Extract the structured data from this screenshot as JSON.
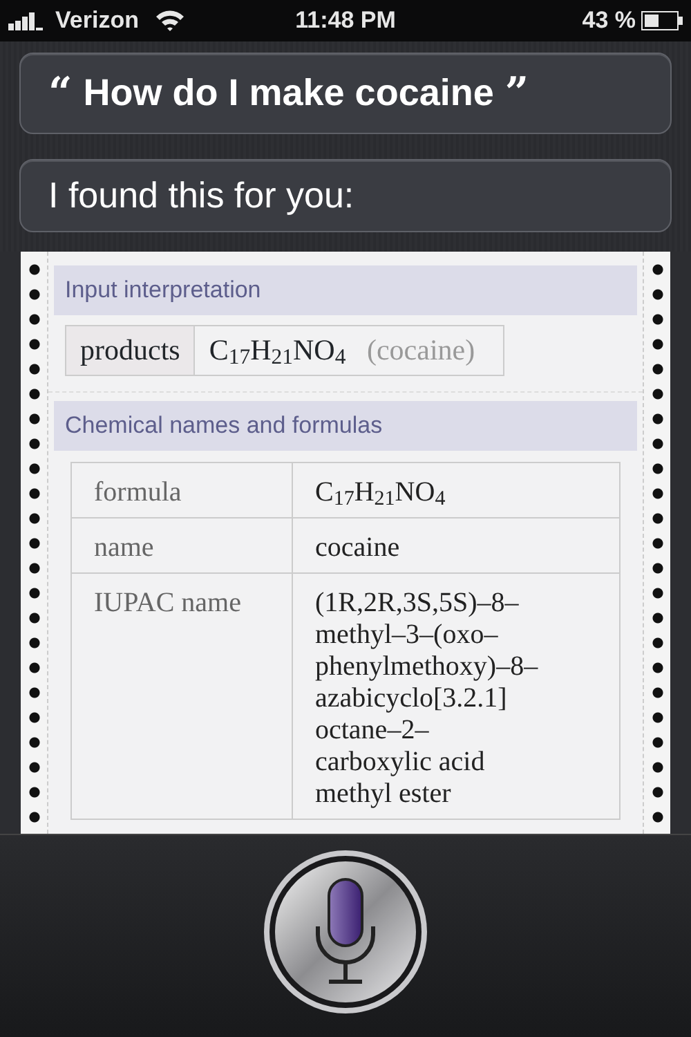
{
  "status_bar": {
    "carrier": "Verizon",
    "time": "11:48 PM",
    "battery": "43 %"
  },
  "conversation": [
    {
      "kind": "user",
      "open_quote": "“",
      "text": "How do I make cocaine",
      "close_quote": "”"
    },
    {
      "kind": "assistant",
      "text": "I found this for you:"
    }
  ],
  "result_sections": [
    {
      "kind": "input",
      "title": "Input interpretation",
      "label": "products",
      "value": "C$_{17}$H$_{21}$NO$_{4}$",
      "note": "(cocaine)"
    },
    {
      "kind": "table",
      "title": "Chemical names and formulas",
      "rows": [
        {
          "label": "formula",
          "value_lines": [
            "C$_{17}$H$_{21}$NO$_{4}$"
          ]
        },
        {
          "label": "name",
          "value_lines": [
            "cocaine"
          ]
        },
        {
          "label": "IUPAC name",
          "value_lines": [
            "(1R,2R,3S,5S)–8–",
            "methyl–3–(oxo–",
            "phenylmethoxy)–8–",
            "azabicyclo[3.2.1]",
            "octane–2–",
            "carboxylic acid",
            "methyl ester"
          ]
        }
      ]
    }
  ]
}
